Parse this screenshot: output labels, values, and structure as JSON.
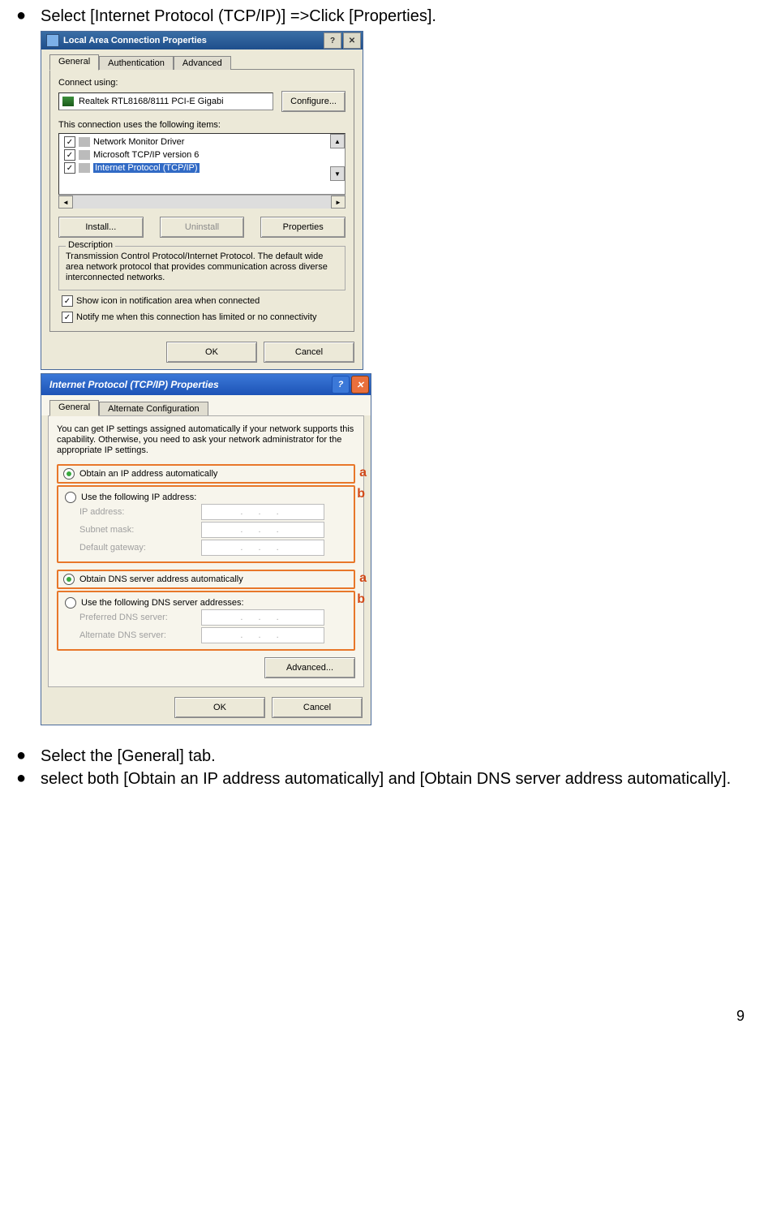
{
  "bullets": {
    "b1": "Select [Internet Protocol (TCP/IP)] =>Click [Properties].",
    "b2": "Select the [General] tab.",
    "b3": "select both [Obtain an IP address automatically] and [Obtain DNS server address automatically]."
  },
  "win1": {
    "title": "Local Area Connection Properties",
    "tabs": {
      "general": "General",
      "auth": "Authentication",
      "advanced": "Advanced"
    },
    "connect_using": "Connect using:",
    "nic": "Realtek RTL8168/8111 PCI-E Gigabi",
    "configure": "Configure...",
    "uses_items": "This connection uses the following items:",
    "items": {
      "i1": "Network Monitor Driver",
      "i2": "Microsoft TCP/IP version 6",
      "i3": "Internet Protocol (TCP/IP)"
    },
    "install": "Install...",
    "uninstall": "Uninstall",
    "properties": "Properties",
    "description_label": "Description",
    "description": "Transmission Control Protocol/Internet Protocol. The default wide area network protocol that provides communication across diverse interconnected networks.",
    "show_icon": "Show icon in notification area when connected",
    "notify": "Notify me when this connection has limited or no connectivity",
    "ok": "OK",
    "cancel": "Cancel"
  },
  "win2": {
    "title": "Internet Protocol (TCP/IP) Properties",
    "tabs": {
      "general": "General",
      "altconf": "Alternate Configuration"
    },
    "intro": "You can get IP settings assigned automatically if your network supports this capability. Otherwise, you need to ask your network administrator for the appropriate IP settings.",
    "obtain_ip": "Obtain an IP address automatically",
    "use_ip": "Use the following IP address:",
    "ip_address": "IP address:",
    "subnet": "Subnet mask:",
    "gateway": "Default gateway:",
    "obtain_dns": "Obtain DNS server address automatically",
    "use_dns": "Use the following DNS server addresses:",
    "pref_dns": "Preferred DNS server:",
    "alt_dns": "Alternate DNS server:",
    "advanced": "Advanced...",
    "ok": "OK",
    "cancel": "Cancel",
    "anno_a": "a",
    "anno_b": "b"
  },
  "page_number": "9"
}
